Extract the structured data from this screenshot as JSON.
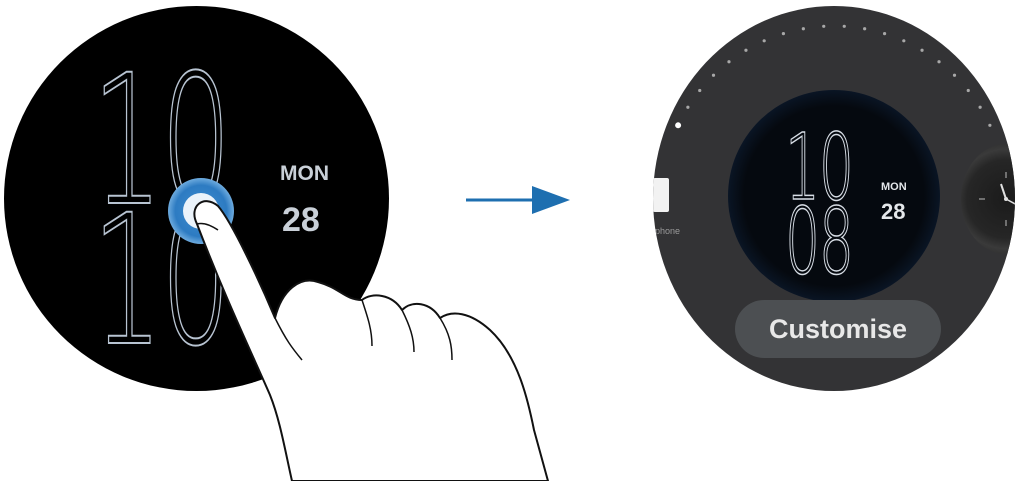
{
  "left_watch": {
    "hour": "10",
    "minute": "10",
    "day": "MON",
    "date": "28"
  },
  "transition": {
    "icon": "arrow-right-icon",
    "color": "#1e6fb0"
  },
  "right_watch": {
    "preview": {
      "hour": "10",
      "minute": "08",
      "day": "MON",
      "date": "28"
    },
    "left_neighbor_label": "phone",
    "customise_button": "Customise",
    "page_indicator": {
      "total": 20,
      "active_index": 0
    }
  },
  "colors": {
    "touch_ring": "#2d7bc2",
    "watch_bg_left": "#000000",
    "watch_bg_right": "#333335",
    "button_bg": "#4c4f52"
  }
}
